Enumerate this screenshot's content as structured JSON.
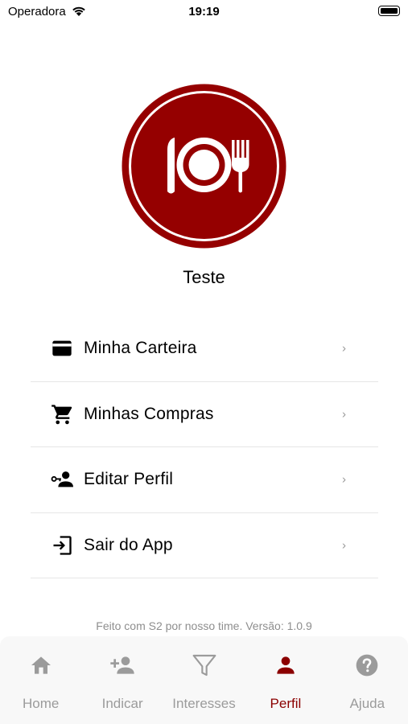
{
  "status_bar": {
    "carrier": "Operadora",
    "time": "19:19"
  },
  "profile": {
    "name": "Teste"
  },
  "menu": {
    "items": [
      {
        "label": "Minha Carteira",
        "icon": "wallet-card-icon"
      },
      {
        "label": "Minhas Compras",
        "icon": "shopping-cart-icon"
      },
      {
        "label": "Editar Perfil",
        "icon": "edit-profile-icon"
      },
      {
        "label": "Sair do App",
        "icon": "logout-icon"
      }
    ],
    "chevron": "›"
  },
  "footer": {
    "text": "Feito com S2 por nosso time. Versão: 1.0.9"
  },
  "tabs": [
    {
      "label": "Home",
      "icon": "home-icon",
      "active": false
    },
    {
      "label": "Indicar",
      "icon": "add-person-icon",
      "active": false
    },
    {
      "label": "Interesses",
      "icon": "filter-icon",
      "active": false
    },
    {
      "label": "Perfil",
      "icon": "person-icon",
      "active": true
    },
    {
      "label": "Ajuda",
      "icon": "help-icon",
      "active": false
    }
  ],
  "colors": {
    "brand": "#8b0000",
    "inactive_tab": "#9b9b9b",
    "tab_bar_bg": "#f8f8f8"
  }
}
